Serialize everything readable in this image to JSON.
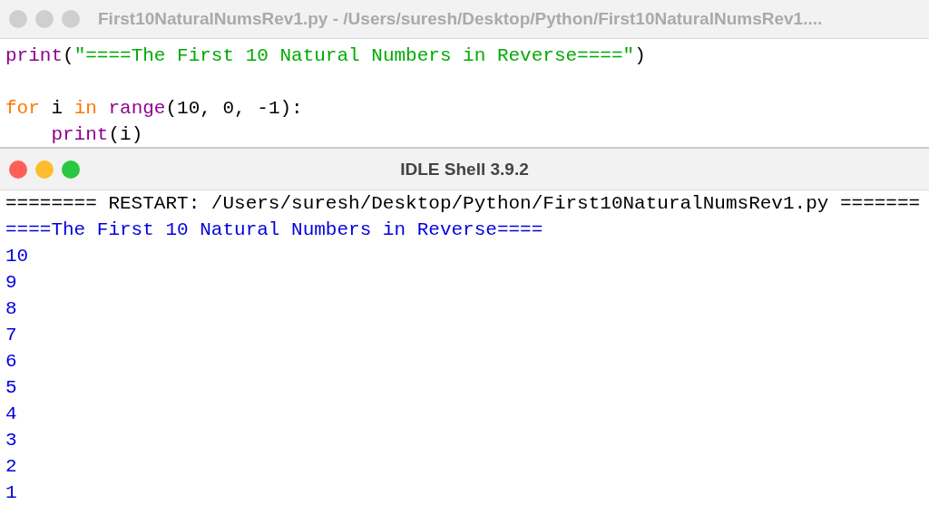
{
  "editor": {
    "title": "First10NaturalNumsRev1.py - /Users/suresh/Desktop/Python/First10NaturalNumsRev1....",
    "active": false,
    "lines": [
      {
        "kind": "code",
        "tokens": [
          {
            "kind": "builtin",
            "text": "print"
          },
          {
            "kind": "plain",
            "text": "("
          },
          {
            "kind": "string",
            "text": "\"====The First 10 Natural Numbers in Reverse====\""
          },
          {
            "kind": "plain",
            "text": ")"
          }
        ]
      },
      {
        "kind": "blank"
      },
      {
        "kind": "code",
        "tokens": [
          {
            "kind": "keyword",
            "text": "for"
          },
          {
            "kind": "plain",
            "text": " i "
          },
          {
            "kind": "keyword",
            "text": "in"
          },
          {
            "kind": "builtin",
            "text": " range"
          },
          {
            "kind": "plain",
            "text": "(10, 0, -1):"
          }
        ],
        "children": [
          {
            "kind": "code",
            "tokens": [
              {
                "kind": "builtin",
                "text": "print"
              },
              {
                "kind": "plain",
                "text": "(i)"
              }
            ]
          }
        ]
      }
    ]
  },
  "shell": {
    "title": "IDLE Shell 3.9.2",
    "active": true,
    "lines": [
      {
        "kind": "restart",
        "text": "======== RESTART: /Users/suresh/Desktop/Python/First10NaturalNumsRev1.py ======="
      },
      {
        "kind": "stdout",
        "text": "====The First 10 Natural Numbers in Reverse===="
      },
      {
        "kind": "stdout",
        "text": "10"
      },
      {
        "kind": "stdout",
        "text": "9"
      },
      {
        "kind": "stdout",
        "text": "8"
      },
      {
        "kind": "stdout",
        "text": "7"
      },
      {
        "kind": "stdout",
        "text": "6"
      },
      {
        "kind": "stdout",
        "text": "5"
      },
      {
        "kind": "stdout",
        "text": "4"
      },
      {
        "kind": "stdout",
        "text": "3"
      },
      {
        "kind": "stdout",
        "text": "2"
      },
      {
        "kind": "stdout",
        "text": "1"
      }
    ]
  }
}
